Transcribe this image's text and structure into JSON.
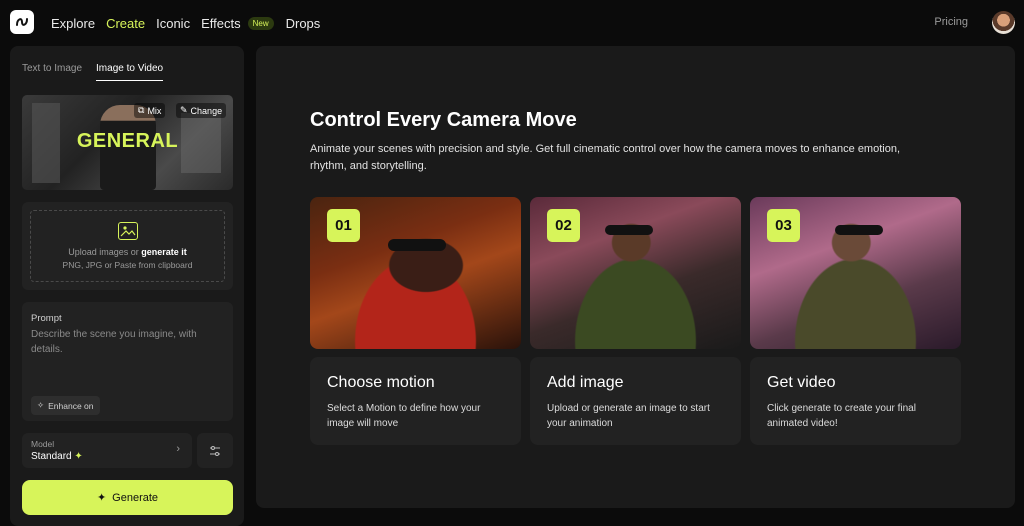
{
  "nav": {
    "items": [
      {
        "label": "Explore",
        "active": false
      },
      {
        "label": "Create",
        "active": true
      },
      {
        "label": "Iconic",
        "active": false
      },
      {
        "label": "Effects",
        "active": false
      },
      {
        "label": "Drops",
        "active": false
      }
    ],
    "new_badge": "New",
    "pricing": "Pricing"
  },
  "left": {
    "tabs": [
      "Text to Image",
      "Image to Video"
    ],
    "active_tab": "Image to Video",
    "preview": {
      "overlay_text": "GENERAL",
      "mix_label": "Mix",
      "change_label": "Change"
    },
    "upload": {
      "line1_prefix": "Upload images or ",
      "line1_link": "generate it",
      "line2": "PNG, JPG or Paste from clipboard"
    },
    "prompt": {
      "label": "Prompt",
      "placeholder": "Describe the scene you imagine, with details.",
      "enhance_label": "Enhance on"
    },
    "model": {
      "label": "Model",
      "value": "Standard",
      "icon": "sparkle-icon"
    },
    "generate_label": "Generate"
  },
  "main": {
    "title": "Control Every Camera Move",
    "description": "Animate your scenes with precision and style. Get full cinematic control over how the camera moves to enhance emotion, rhythm, and storytelling.",
    "cards": [
      {
        "num": "01",
        "title": "Choose motion",
        "desc": "Select a Motion to define how your image will move"
      },
      {
        "num": "02",
        "title": "Add image",
        "desc": "Upload or generate an image to start your animation"
      },
      {
        "num": "03",
        "title": "Get video",
        "desc": "Click generate to create your final animated video!"
      }
    ]
  },
  "colors": {
    "accent": "#d7f45a",
    "panel": "#1a1a1a",
    "card": "#222222",
    "background": "#0b0b0b"
  }
}
